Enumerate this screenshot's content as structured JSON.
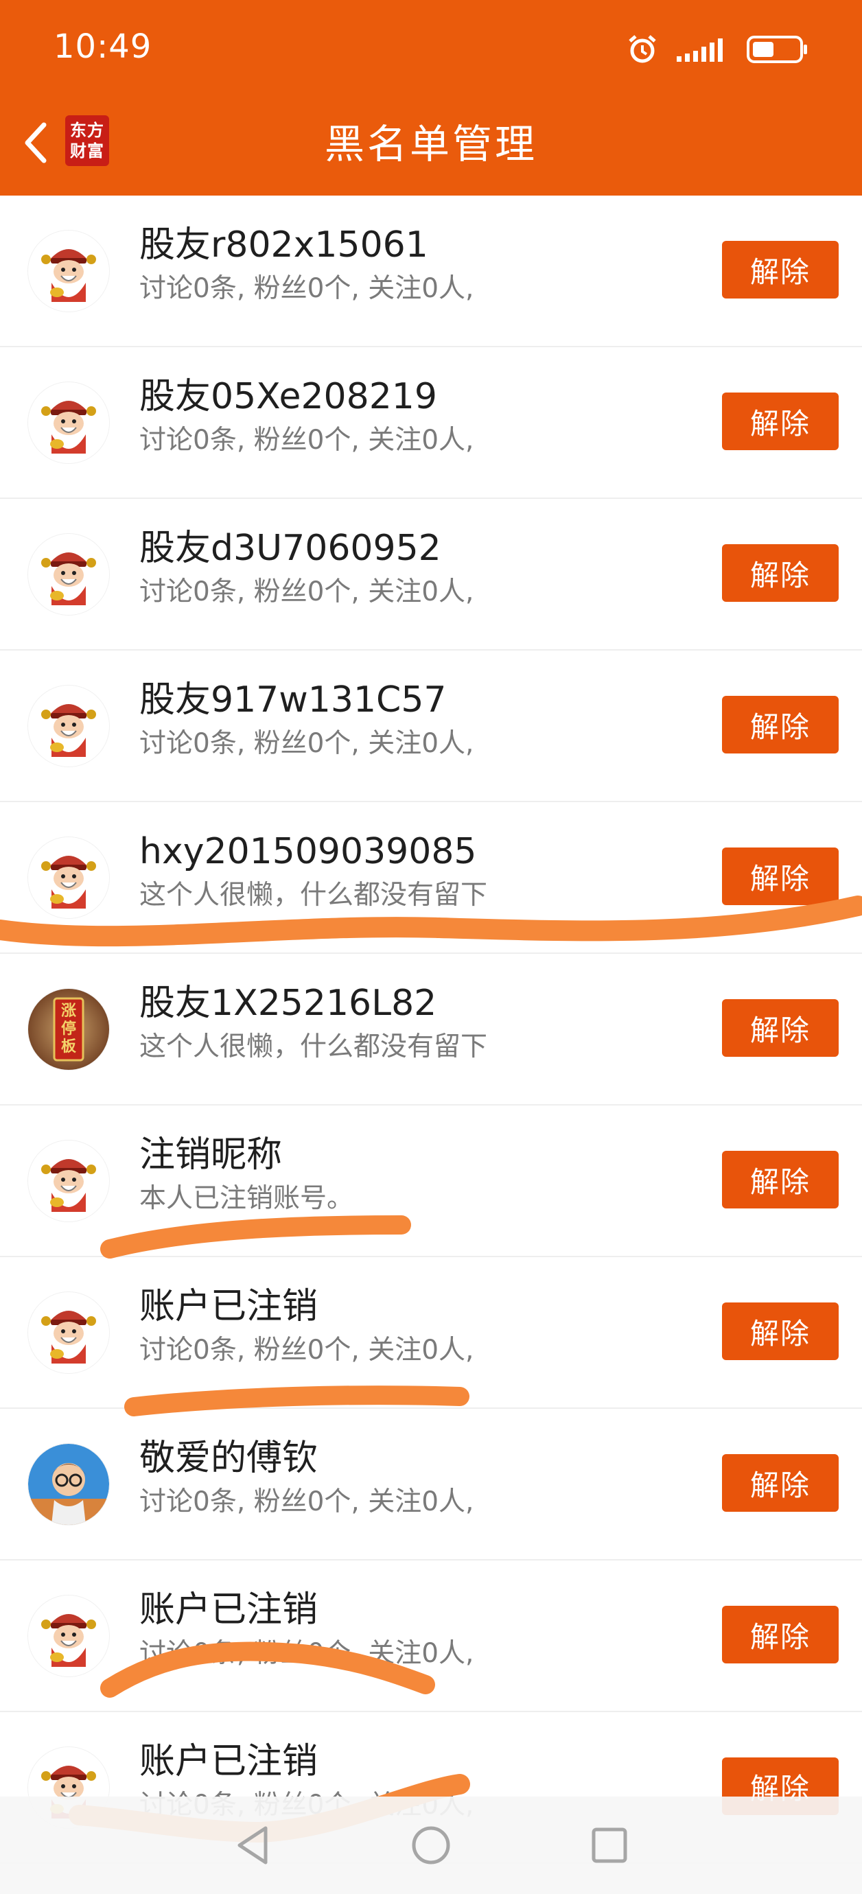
{
  "status_bar": {
    "time": "10:49"
  },
  "header": {
    "title": "黑名单管理",
    "logo_line1": "东方",
    "logo_line2": "财富"
  },
  "list_rows": [
    {
      "name": "股友r802x15061",
      "subtitle": "讨论0条, 粉丝0个, 关注0人,",
      "action": "解除",
      "avatar": "cartoon-mascot"
    },
    {
      "name": "股友05Xe208219",
      "subtitle": "讨论0条, 粉丝0个, 关注0人,",
      "action": "解除",
      "avatar": "cartoon-mascot"
    },
    {
      "name": "股友d3U7060952",
      "subtitle": "讨论0条, 粉丝0个, 关注0人,",
      "action": "解除",
      "avatar": "cartoon-mascot"
    },
    {
      "name": "股友917w131C57",
      "subtitle": "讨论0条, 粉丝0个, 关注0人,",
      "action": "解除",
      "avatar": "cartoon-mascot"
    },
    {
      "name": "hxy201509039085",
      "subtitle": "这个人很懒，什么都没有留下",
      "action": "解除",
      "avatar": "cartoon-mascot"
    },
    {
      "name": "股友1X25216L82",
      "subtitle": "这个人很懒，什么都没有留下",
      "action": "解除",
      "avatar": "red-plaque-photo",
      "avatar_text": "涨停板"
    },
    {
      "name": "注销昵称",
      "subtitle": "本人已注销账号。",
      "action": "解除",
      "avatar": "cartoon-mascot"
    },
    {
      "name": "账户已注销",
      "subtitle": "讨论0条, 粉丝0个, 关注0人,",
      "action": "解除",
      "avatar": "cartoon-mascot"
    },
    {
      "name": "敬爱的傅钦",
      "subtitle": "讨论0条, 粉丝0个, 关注0人,",
      "action": "解除",
      "avatar": "cartoon-boy-glasses"
    },
    {
      "name": "账户已注销",
      "subtitle": "讨论0条, 粉丝0个, 关注0人,",
      "action": "解除",
      "avatar": "cartoon-mascot"
    },
    {
      "name": "账户已注销",
      "subtitle": "讨论0条, 粉丝0个, 关注0人,",
      "action": "解除",
      "avatar": "cartoon-mascot"
    }
  ],
  "colors": {
    "brand": "#ea5b0c",
    "button": "#e8540b",
    "scribble": "#f5883a"
  },
  "icons": [
    "chevron-left-icon",
    "alarm-icon",
    "signal-icon",
    "battery-icon",
    "nav-back-icon",
    "nav-home-icon",
    "nav-recents-icon"
  ]
}
